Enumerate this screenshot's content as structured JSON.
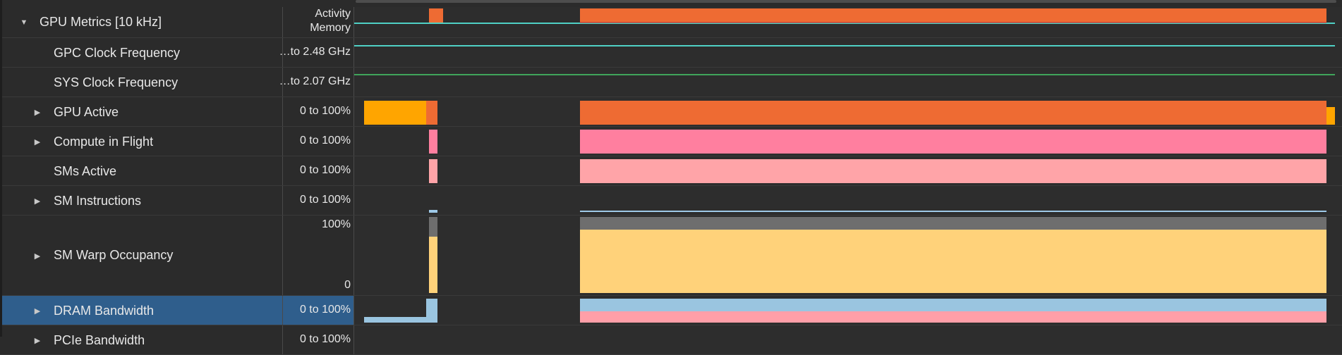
{
  "rows": [
    {
      "id": "gpu-metrics",
      "label": "GPU Metrics [10 kHz]",
      "range_lines": [
        "Activity",
        "Memory"
      ],
      "expander": "open"
    },
    {
      "id": "gpc-clock",
      "label": "GPC Clock Frequency",
      "range": "…to 2.48 GHz"
    },
    {
      "id": "sys-clock",
      "label": "SYS Clock Frequency",
      "range": "…to 2.07 GHz"
    },
    {
      "id": "gpu-active",
      "label": "GPU Active",
      "range": "0 to 100%",
      "expander": "closed"
    },
    {
      "id": "compute-in-flight",
      "label": "Compute in Flight",
      "range": "0 to 100%",
      "expander": "closed"
    },
    {
      "id": "sms-active",
      "label": "SMs Active",
      "range": "0 to 100%"
    },
    {
      "id": "sm-instructions",
      "label": "SM Instructions",
      "range": "0 to 100%",
      "expander": "closed"
    },
    {
      "id": "sm-warp-occupancy",
      "label": "SM Warp Occupancy",
      "range_top": "100%",
      "range_bottom": "0",
      "expander": "closed"
    },
    {
      "id": "dram-bandwidth",
      "label": "DRAM Bandwidth",
      "range": "0 to 100%",
      "expander": "closed",
      "selected": true
    },
    {
      "id": "pcie-bandwidth",
      "label": "PCIe Bandwidth",
      "range": "0 to 100%",
      "expander": "closed"
    }
  ],
  "colors": {
    "activity_orange": "#ee6b33",
    "gpu_active_yellow": "#ffa500",
    "compute_pink": "#ff7f9f",
    "sms_pink": "#ffa4a8",
    "sm_instr_blue": "#9ec9e8",
    "warp_yellow": "#ffd27a",
    "warp_gray": "#6e6e6e",
    "dram_blue": "#9ac5e0",
    "dram_pink": "#ff9fa8",
    "clock_cyan": "#4fd1c5",
    "clock_green": "#3fa45b",
    "selected_bg": "#2f5e8c"
  },
  "icons": {
    "expander_open": "triangle-down-icon",
    "expander_closed": "triangle-right-icon"
  }
}
